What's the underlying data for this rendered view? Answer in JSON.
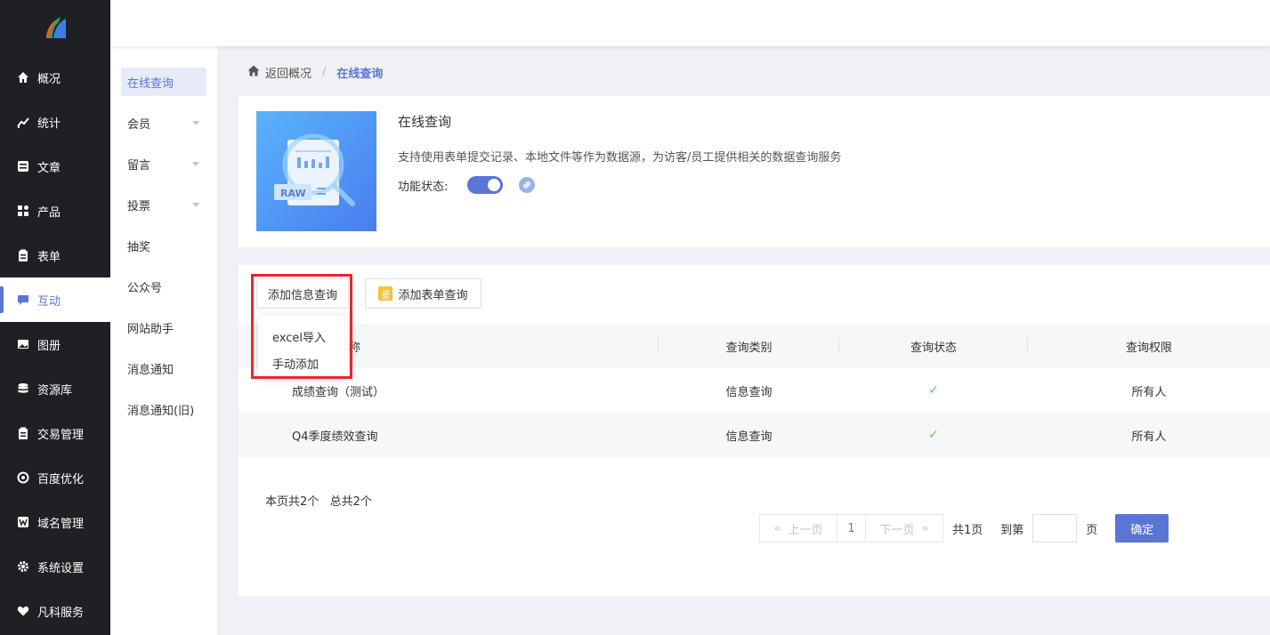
{
  "nav": {
    "items": [
      {
        "label": "概况",
        "icon": "home-icon"
      },
      {
        "label": "统计",
        "icon": "chart-icon"
      },
      {
        "label": "文章",
        "icon": "article-icon"
      },
      {
        "label": "产品",
        "icon": "grid-icon"
      },
      {
        "label": "表单",
        "icon": "clipboard-icon"
      },
      {
        "label": "互动",
        "icon": "chat-icon",
        "active": true
      },
      {
        "label": "图册",
        "icon": "image-icon"
      },
      {
        "label": "资源库",
        "icon": "database-icon"
      },
      {
        "label": "交易管理",
        "icon": "clipboard-icon"
      },
      {
        "label": "百度优化",
        "icon": "target-icon"
      },
      {
        "label": "域名管理",
        "icon": "w-icon"
      },
      {
        "label": "系统设置",
        "icon": "gear-icon"
      },
      {
        "label": "凡科服务",
        "icon": "heart-icon"
      }
    ]
  },
  "subnav": {
    "items": [
      {
        "label": "在线查询",
        "active": true,
        "caret": false
      },
      {
        "label": "会员",
        "caret": true
      },
      {
        "label": "留言",
        "caret": true
      },
      {
        "label": "投票",
        "caret": true
      },
      {
        "label": "抽奖",
        "caret": false
      },
      {
        "label": "公众号",
        "caret": false
      },
      {
        "label": "网站助手",
        "caret": false
      },
      {
        "label": "消息通知",
        "caret": false
      },
      {
        "label": "消息通知(旧)",
        "caret": false
      }
    ]
  },
  "breadcrumb": {
    "back": "返回概况",
    "sep": "/",
    "current": "在线查询"
  },
  "intro": {
    "title": "在线查询",
    "description": "支持使用表单提交记录、本地文件等作为数据源，为访客/员工提供相关的数据查询服务",
    "status_label": "功能状态:",
    "raw_label": "RAW"
  },
  "toolbar": {
    "add_info": "添加信息查询",
    "add_form": "添加表单查询",
    "star": "星"
  },
  "dropdown": {
    "items": [
      "excel导入",
      "手动添加"
    ]
  },
  "table": {
    "headers": [
      "称",
      "查询类别",
      "查询状态",
      "查询权限"
    ],
    "rows": [
      {
        "name": "成绩查询（测试）",
        "category": "信息查询",
        "status": "✓",
        "permission": "所有人"
      },
      {
        "name": "Q4季度绩效查询",
        "category": "信息查询",
        "status": "✓",
        "permission": "所有人"
      }
    ]
  },
  "pageinfo": "本页共2个   总共2个",
  "pager": {
    "prev": "上一页",
    "page": "1",
    "next": "下一页",
    "total": "共1页",
    "goto": "到第",
    "unit": "页",
    "confirm": "确定"
  },
  "colors": {
    "accent": "#5a75d6",
    "nav_bg": "#1f2024",
    "highlight": "#e8262d",
    "check": "#6ac36a"
  }
}
